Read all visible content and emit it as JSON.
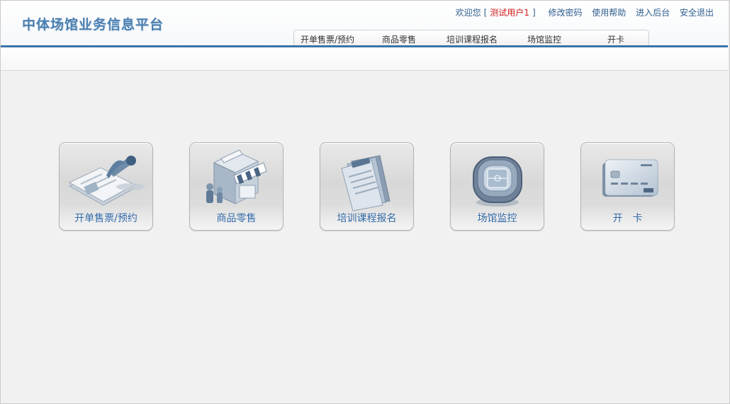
{
  "header": {
    "logo": "中体场馆业务信息平台",
    "welcome": "欢迎您",
    "bracket_open": "[",
    "user": "测试用户1",
    "bracket_close": "]",
    "links": [
      "修改密码",
      "使用帮助",
      "进入后台",
      "安全退出"
    ]
  },
  "tabs": [
    "开单售票/预约",
    "商品零售",
    "培训课程报名",
    "场馆监控",
    "开卡"
  ],
  "modules": [
    {
      "label": "开单售票/预约",
      "icon": "ticket-documents-icon"
    },
    {
      "label": "商品零售",
      "icon": "retail-shop-icon"
    },
    {
      "label": "培训课程报名",
      "icon": "course-documents-icon"
    },
    {
      "label": "场馆监控",
      "icon": "stadium-icon"
    },
    {
      "label": "开　卡",
      "icon": "bank-card-icon"
    }
  ],
  "colors": {
    "accent": "#3a73a8",
    "user": "#d01818",
    "link": "#2f5e8e",
    "card_label": "#2c63a0"
  }
}
